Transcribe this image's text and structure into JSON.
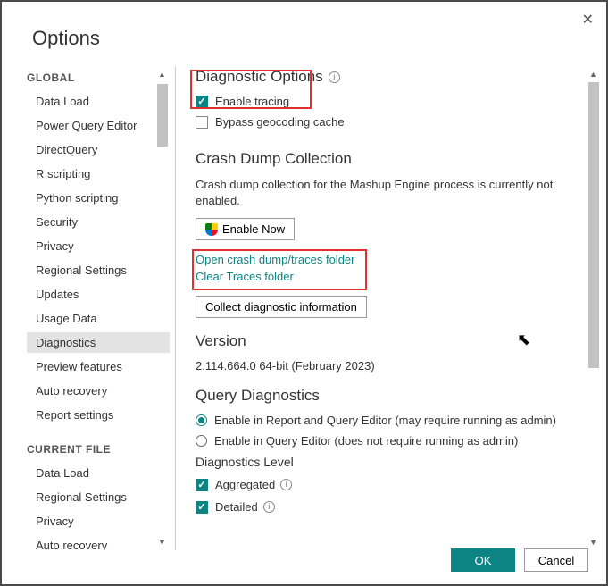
{
  "dialog": {
    "title": "Options"
  },
  "sidebar": {
    "sections": [
      {
        "label": "GLOBAL",
        "items": [
          "Data Load",
          "Power Query Editor",
          "DirectQuery",
          "R scripting",
          "Python scripting",
          "Security",
          "Privacy",
          "Regional Settings",
          "Updates",
          "Usage Data",
          "Diagnostics",
          "Preview features",
          "Auto recovery",
          "Report settings"
        ],
        "selected": "Diagnostics"
      },
      {
        "label": "CURRENT FILE",
        "items": [
          "Data Load",
          "Regional Settings",
          "Privacy",
          "Auto recovery"
        ]
      }
    ]
  },
  "content": {
    "diagnostic_options": {
      "heading": "Diagnostic Options",
      "enable_tracing": {
        "label": "Enable tracing",
        "checked": true
      },
      "bypass_geocoding": {
        "label": "Bypass geocoding cache",
        "checked": false
      }
    },
    "crash_dump": {
      "heading": "Crash Dump Collection",
      "description": "Crash dump collection for the Mashup Engine process is currently not enabled.",
      "enable_now": "Enable Now",
      "open_folder": "Open crash dump/traces folder",
      "clear_folder": "Clear Traces folder",
      "collect_info": "Collect diagnostic information"
    },
    "version": {
      "heading": "Version",
      "value": "2.114.664.0 64-bit (February 2023)"
    },
    "query_diag": {
      "heading": "Query Diagnostics",
      "opt1": "Enable in Report and Query Editor (may require running as admin)",
      "opt2": "Enable in Query Editor (does not require running as admin)",
      "selected": 0,
      "level_heading": "Diagnostics Level",
      "aggregated": {
        "label": "Aggregated",
        "checked": true
      },
      "detailed": {
        "label": "Detailed",
        "checked": true
      }
    }
  },
  "footer": {
    "ok": "OK",
    "cancel": "Cancel"
  }
}
